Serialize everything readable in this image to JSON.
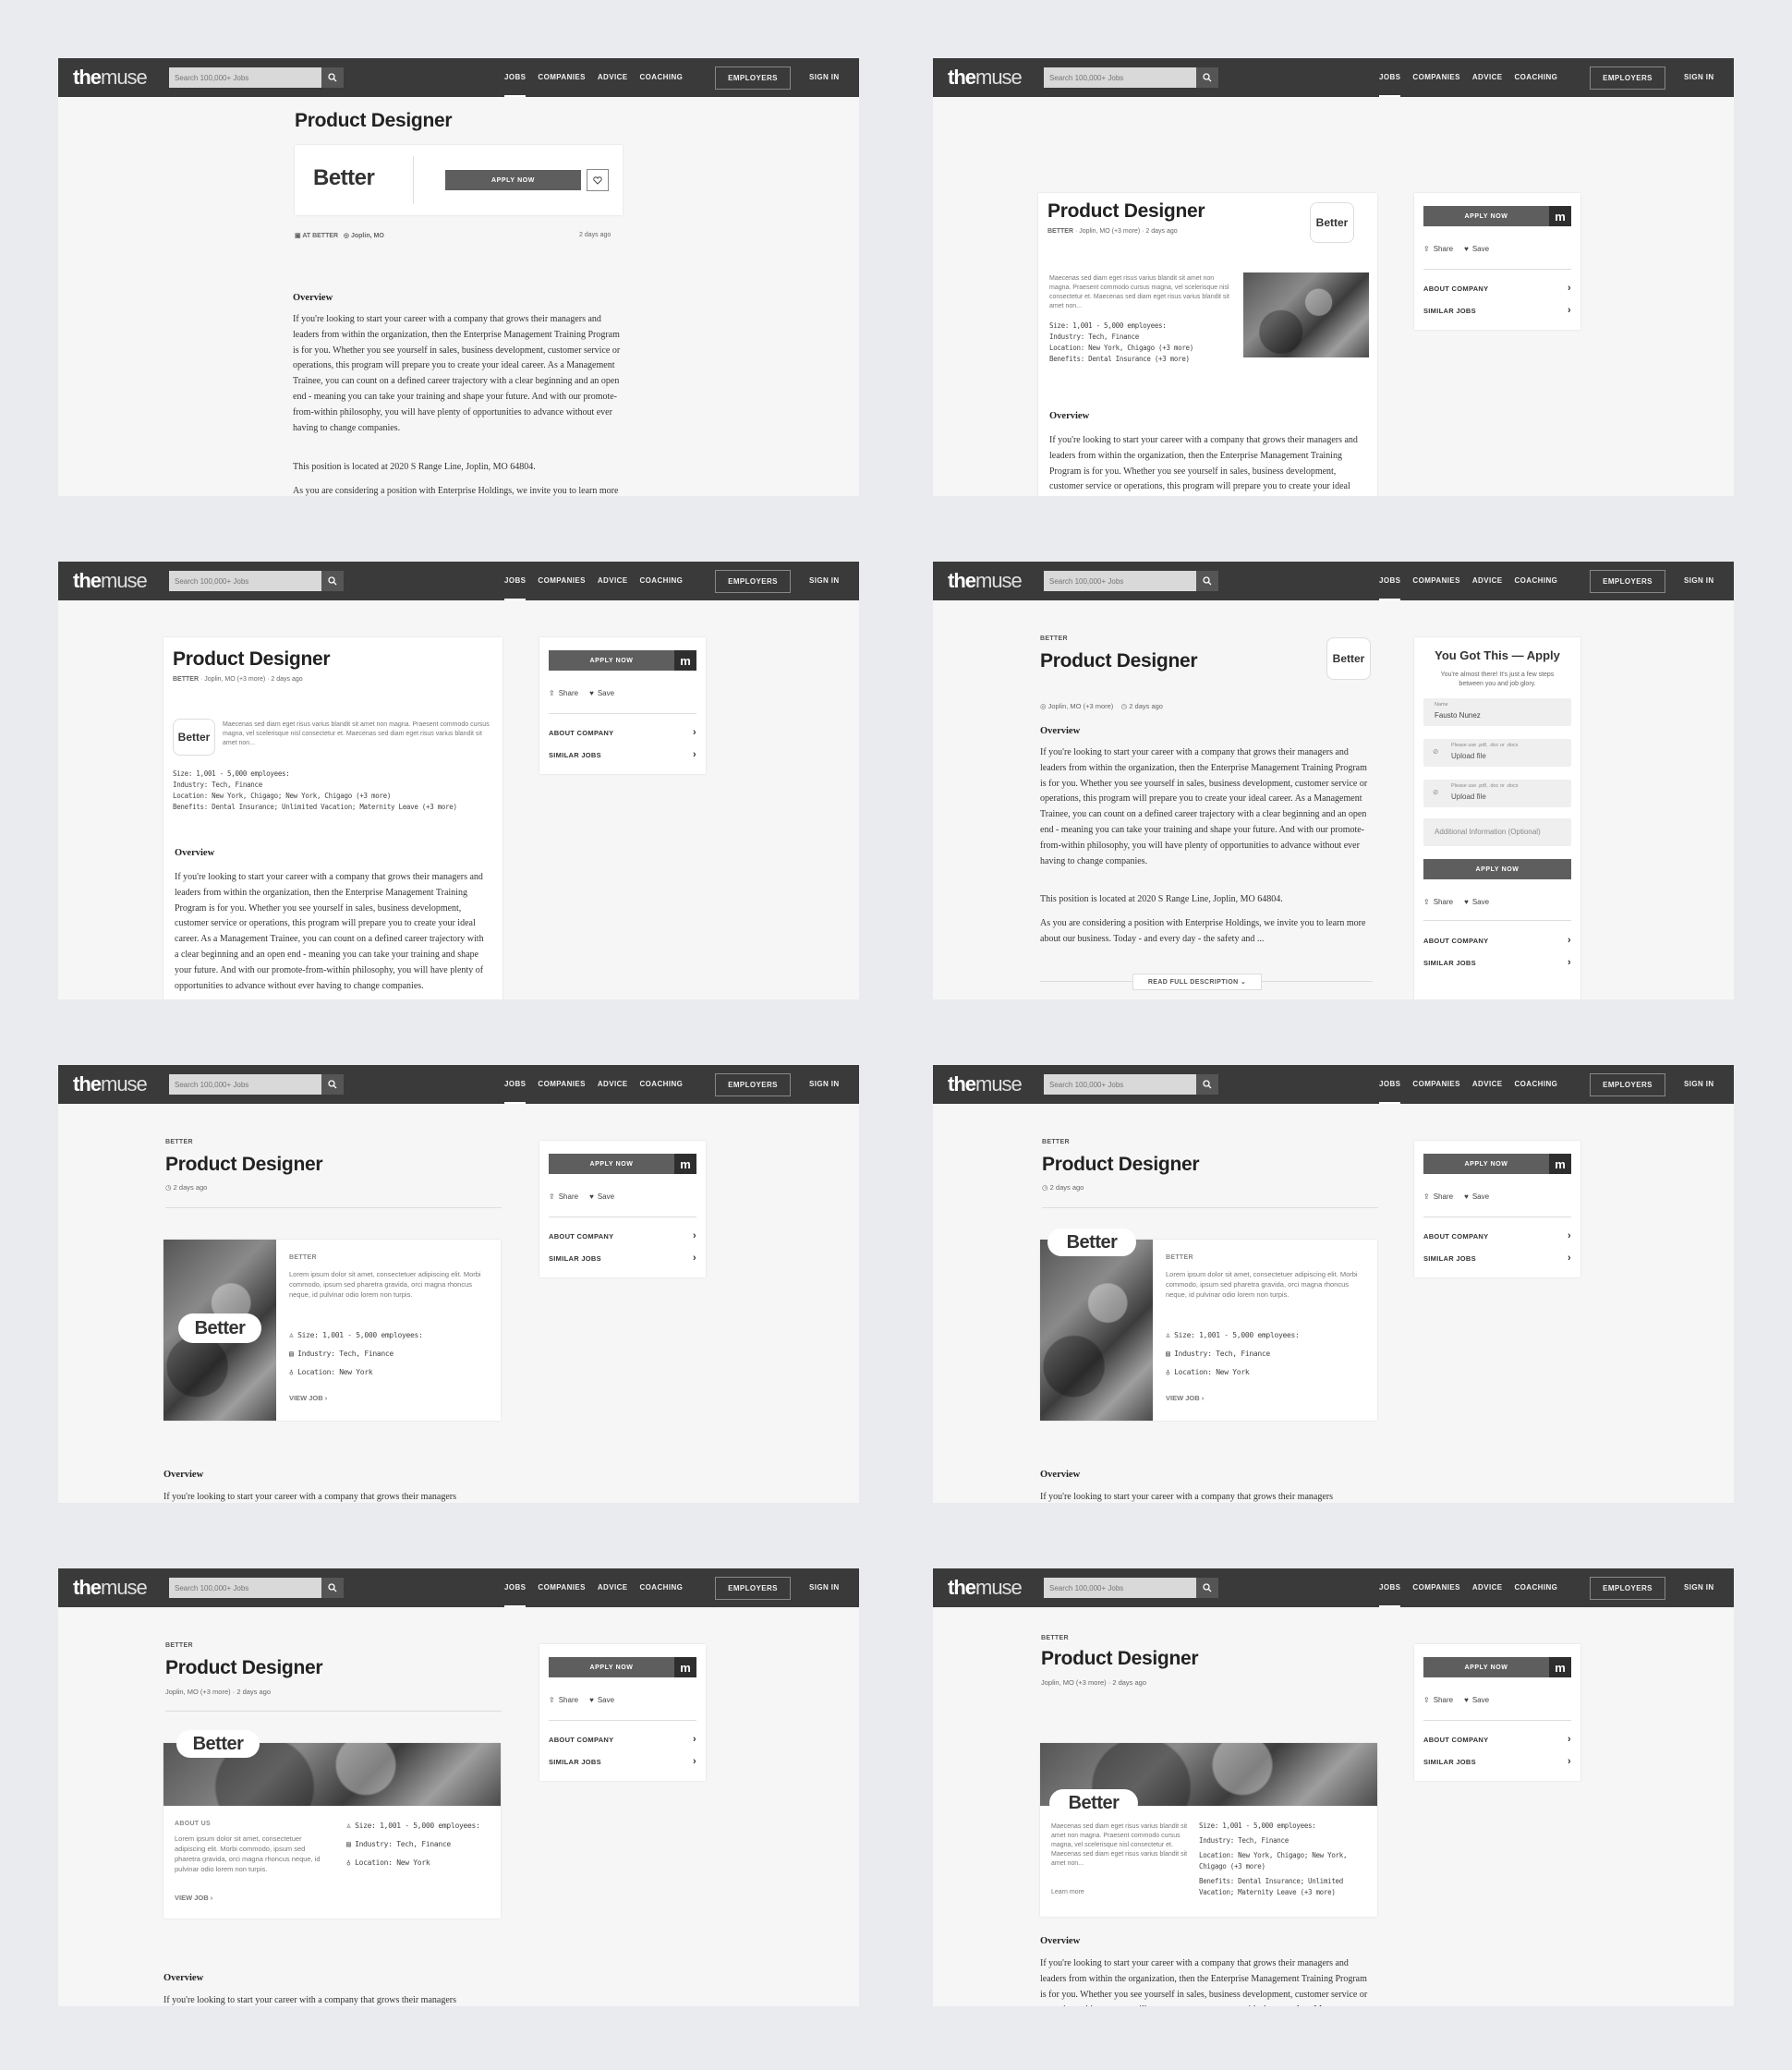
{
  "nav": {
    "logo_bold": "the",
    "logo_light": "muse",
    "search_placeholder": "Search 100,000+ Jobs",
    "links": [
      "JOBS",
      "COMPANIES",
      "ADVICE",
      "COACHING"
    ],
    "employers": "EMPLOYERS",
    "sign_in": "SIGN IN"
  },
  "job": {
    "title": "Product Designer",
    "company": "Better",
    "company_caps": "BETTER",
    "at_company": "AT BETTER",
    "location": "Joplin, MO",
    "location_more": "Joplin, MO (+3 more)",
    "posted": "2 days ago",
    "apply": "APPLY NOW",
    "share": "Share",
    "save": "Save",
    "about_company": "ABOUT COMPANY",
    "similar_jobs": "SIMILAR JOBS",
    "m": "m"
  },
  "overview": {
    "heading": "Overview",
    "p1": "If you're looking to start your career with a company that grows their managers and leaders from within the organization, then the Enterprise Management Training Program is for you. Whether you see yourself in sales, business development, customer service or operations, this program will prepare you to create your ideal career. As a Management Trainee, you can count on a defined career trajectory with a clear beginning and an open end - meaning you can take your training and shape your future. And with our promote-from-within philosophy, you will have plenty of opportunities to advance without ever having to change companies.",
    "p2": "This position is located at 2020 S Range Line, Joplin, MO 64804.",
    "p3": "As you are considering a position with Enterprise Holdings, we invite you to learn more about our business. Today - and every day - the safety and ...",
    "first_line": "If you're looking to start your career with a company that grows their managers",
    "read_more": "READ FULL DESCRIPTION"
  },
  "company_info": {
    "lorem_short": "Maecenas sed diam eget risus varius blandit sit amet non magna. Praesent commodo cursus magna, vel scelerisque nisl consectetur et. Maecenas sed diam eget risus varius blandit sit amet non...",
    "lorem_long": "Lorem ipsum dolor sit amet, consectetuer adipiscing elit. Morbi commodo, ipsum sed pharetra gravida, orci magna rhoncus neque, id pulvinar odio lorem non turpis.",
    "size": "Size:  1,001 - 5,000 employees:",
    "industry": "Industry:  Tech, Finance",
    "location": "Location:  New York, Chigago  (+3 more)",
    "location_long": "Location:  New York, Chigago; New York, Chigago  (+3 more)",
    "location_ny": "Location:  New York",
    "benefits": "Benefits:  Dental Insurance  (+3 more)",
    "benefits_long": "Benefits:  Dental Insurance; Unlimited Vacation; Maternity Leave  (+3 more)",
    "about_us": "ABOUT US",
    "view_job": "VIEW JOB",
    "learn_more": "Learn more"
  },
  "apply_form": {
    "heading": "You Got This — Apply",
    "sub": "You're almost there! It's just a few steps between you and job glory.",
    "name_label": "Name",
    "name_value": "Fausto Nunez",
    "upload_hint": "Please use .pdf, .doc or .docx",
    "upload": "Upload file",
    "additional": "Additional Information (Optional)",
    "submit": "APPLY NOW"
  }
}
